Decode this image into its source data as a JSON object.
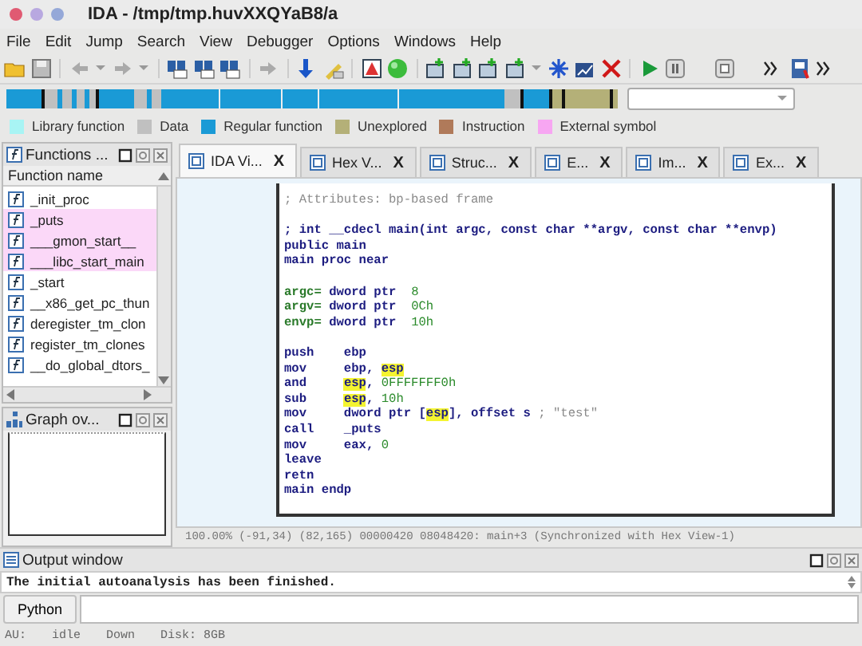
{
  "window": {
    "title": "IDA - /tmp/tmp.huvXXQYaB8/a"
  },
  "menu": [
    "File",
    "Edit",
    "Jump",
    "Search",
    "View",
    "Debugger",
    "Options",
    "Windows",
    "Help"
  ],
  "legend": [
    {
      "label": "Library function",
      "color": "#a8f4f4"
    },
    {
      "label": "Data",
      "color": "#c0c0c0"
    },
    {
      "label": "Regular function",
      "color": "#1a9ad6"
    },
    {
      "label": "Unexplored",
      "color": "#b4b078"
    },
    {
      "label": "Instruction",
      "color": "#b07a5a"
    },
    {
      "label": "External symbol",
      "color": "#f7a6f2"
    }
  ],
  "functions_panel": {
    "title": "Functions ...",
    "column": "Function name",
    "items": [
      {
        "name": "_init_proc",
        "kind": "regular"
      },
      {
        "name": "_puts",
        "kind": "external"
      },
      {
        "name": "___gmon_start__",
        "kind": "external"
      },
      {
        "name": "___libc_start_main",
        "kind": "external"
      },
      {
        "name": "_start",
        "kind": "regular"
      },
      {
        "name": "__x86_get_pc_thun",
        "kind": "regular"
      },
      {
        "name": "deregister_tm_clon",
        "kind": "regular"
      },
      {
        "name": "register_tm_clones",
        "kind": "regular"
      },
      {
        "name": "__do_global_dtors_",
        "kind": "regular"
      }
    ]
  },
  "graph_panel": {
    "title": "Graph ov..."
  },
  "tabs": [
    {
      "label": "IDA Vi...",
      "selected": true,
      "close": "X"
    },
    {
      "label": "Hex V...",
      "selected": false,
      "close": "X"
    },
    {
      "label": "Struc...",
      "selected": false,
      "close": "X"
    },
    {
      "label": "E...",
      "selected": false,
      "close": "X"
    },
    {
      "label": "Im...",
      "selected": false,
      "close": "X"
    },
    {
      "label": "Ex...",
      "selected": false,
      "close": "X"
    }
  ],
  "code_lines": [
    {
      "gap_before": false,
      "segments": [
        {
          "text": "; Attributes: bp-based frame",
          "kind": "comment"
        }
      ]
    },
    {
      "gap_before": true,
      "segments": [
        {
          "text": "; int __cdecl main(int argc, const char **argv, const char **envp)",
          "kind": "keyword"
        }
      ]
    },
    {
      "gap_before": false,
      "segments": [
        {
          "text": "public main",
          "kind": "keyword"
        }
      ]
    },
    {
      "gap_before": false,
      "segments": [
        {
          "text": "main proc near",
          "kind": "keyword"
        }
      ]
    },
    {
      "gap_before": true,
      "segments": [
        {
          "text": "argc=",
          "kind": "label"
        },
        {
          "text": " dword ptr  ",
          "kind": "keyword"
        },
        {
          "text": "8",
          "kind": "number"
        }
      ]
    },
    {
      "gap_before": false,
      "segments": [
        {
          "text": "argv=",
          "kind": "label"
        },
        {
          "text": " dword ptr  ",
          "kind": "keyword"
        },
        {
          "text": "0Ch",
          "kind": "number"
        }
      ]
    },
    {
      "gap_before": false,
      "segments": [
        {
          "text": "envp=",
          "kind": "label"
        },
        {
          "text": " dword ptr  ",
          "kind": "keyword"
        },
        {
          "text": "10h",
          "kind": "number"
        }
      ]
    },
    {
      "gap_before": true,
      "segments": [
        {
          "text": "push    ebp",
          "kind": "keyword"
        }
      ]
    },
    {
      "gap_before": false,
      "segments": [
        {
          "text": "mov     ebp, ",
          "kind": "keyword"
        },
        {
          "text": "esp",
          "kind": "highlight"
        }
      ]
    },
    {
      "gap_before": false,
      "segments": [
        {
          "text": "and     ",
          "kind": "keyword"
        },
        {
          "text": "esp",
          "kind": "highlight"
        },
        {
          "text": ", ",
          "kind": "keyword"
        },
        {
          "text": "0FFFFFFF0h",
          "kind": "number"
        }
      ]
    },
    {
      "gap_before": false,
      "segments": [
        {
          "text": "sub     ",
          "kind": "keyword"
        },
        {
          "text": "esp",
          "kind": "highlight"
        },
        {
          "text": ", ",
          "kind": "keyword"
        },
        {
          "text": "10h",
          "kind": "number"
        }
      ]
    },
    {
      "gap_before": false,
      "segments": [
        {
          "text": "mov     dword ptr [",
          "kind": "keyword"
        },
        {
          "text": "esp",
          "kind": "highlight"
        },
        {
          "text": "], offset s ",
          "kind": "keyword"
        },
        {
          "text": "; \"test\"",
          "kind": "comment"
        }
      ]
    },
    {
      "gap_before": false,
      "segments": [
        {
          "text": "call    _puts",
          "kind": "keyword"
        }
      ]
    },
    {
      "gap_before": false,
      "segments": [
        {
          "text": "mov     eax, ",
          "kind": "keyword"
        },
        {
          "text": "0",
          "kind": "number"
        }
      ]
    },
    {
      "gap_before": false,
      "segments": [
        {
          "text": "leave",
          "kind": "keyword"
        }
      ]
    },
    {
      "gap_before": false,
      "segments": [
        {
          "text": "retn",
          "kind": "keyword"
        }
      ]
    },
    {
      "gap_before": false,
      "segments": [
        {
          "text": "main endp",
          "kind": "keyword"
        }
      ]
    }
  ],
  "view_status": "100.00% (-91,34) (82,165) 00000420 08048420: main+3 (Synchronized with Hex View-1)",
  "output_panel": {
    "title": "Output window",
    "message": "The initial autoanalysis has been finished.",
    "button": "Python"
  },
  "status_bar": [
    "AU:",
    "idle",
    "Down",
    "Disk: 8GB"
  ]
}
